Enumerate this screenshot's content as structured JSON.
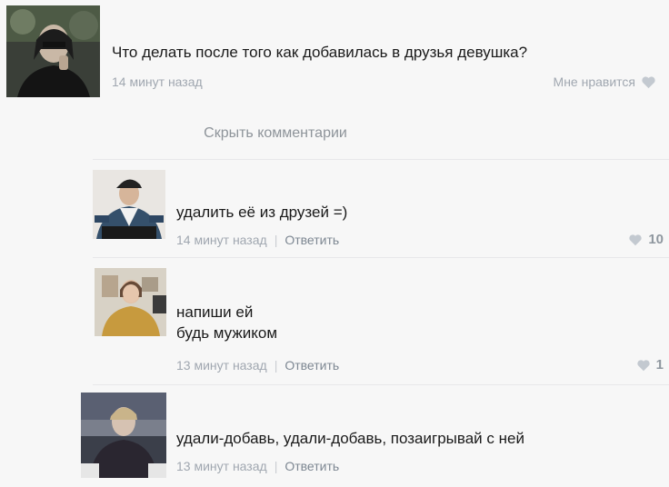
{
  "post": {
    "text": "Что делать после того как добавилась в друзья девушка?",
    "time": "14 минут назад",
    "like_label": "Мне нравится"
  },
  "hide_comments_label": "Скрыть комментарии",
  "reply_label": "Ответить",
  "comments": [
    {
      "lines": [
        "удалить её из друзей =)"
      ],
      "time": "14 минут назад",
      "likes": "10"
    },
    {
      "lines": [
        "напиши ей",
        "будь мужиком"
      ],
      "time": "13 минут назад",
      "likes": "1"
    },
    {
      "lines": [
        "удали-добавь, удали-добавь, позаигрывай с ней"
      ],
      "time": "13 минут назад",
      "likes": ""
    }
  ],
  "colors": {
    "meta_gray": "#a0a7b0",
    "reply_gray": "#7d8792",
    "heart_gray": "#c3c9d0"
  },
  "icons": {
    "like": "heart-icon"
  }
}
